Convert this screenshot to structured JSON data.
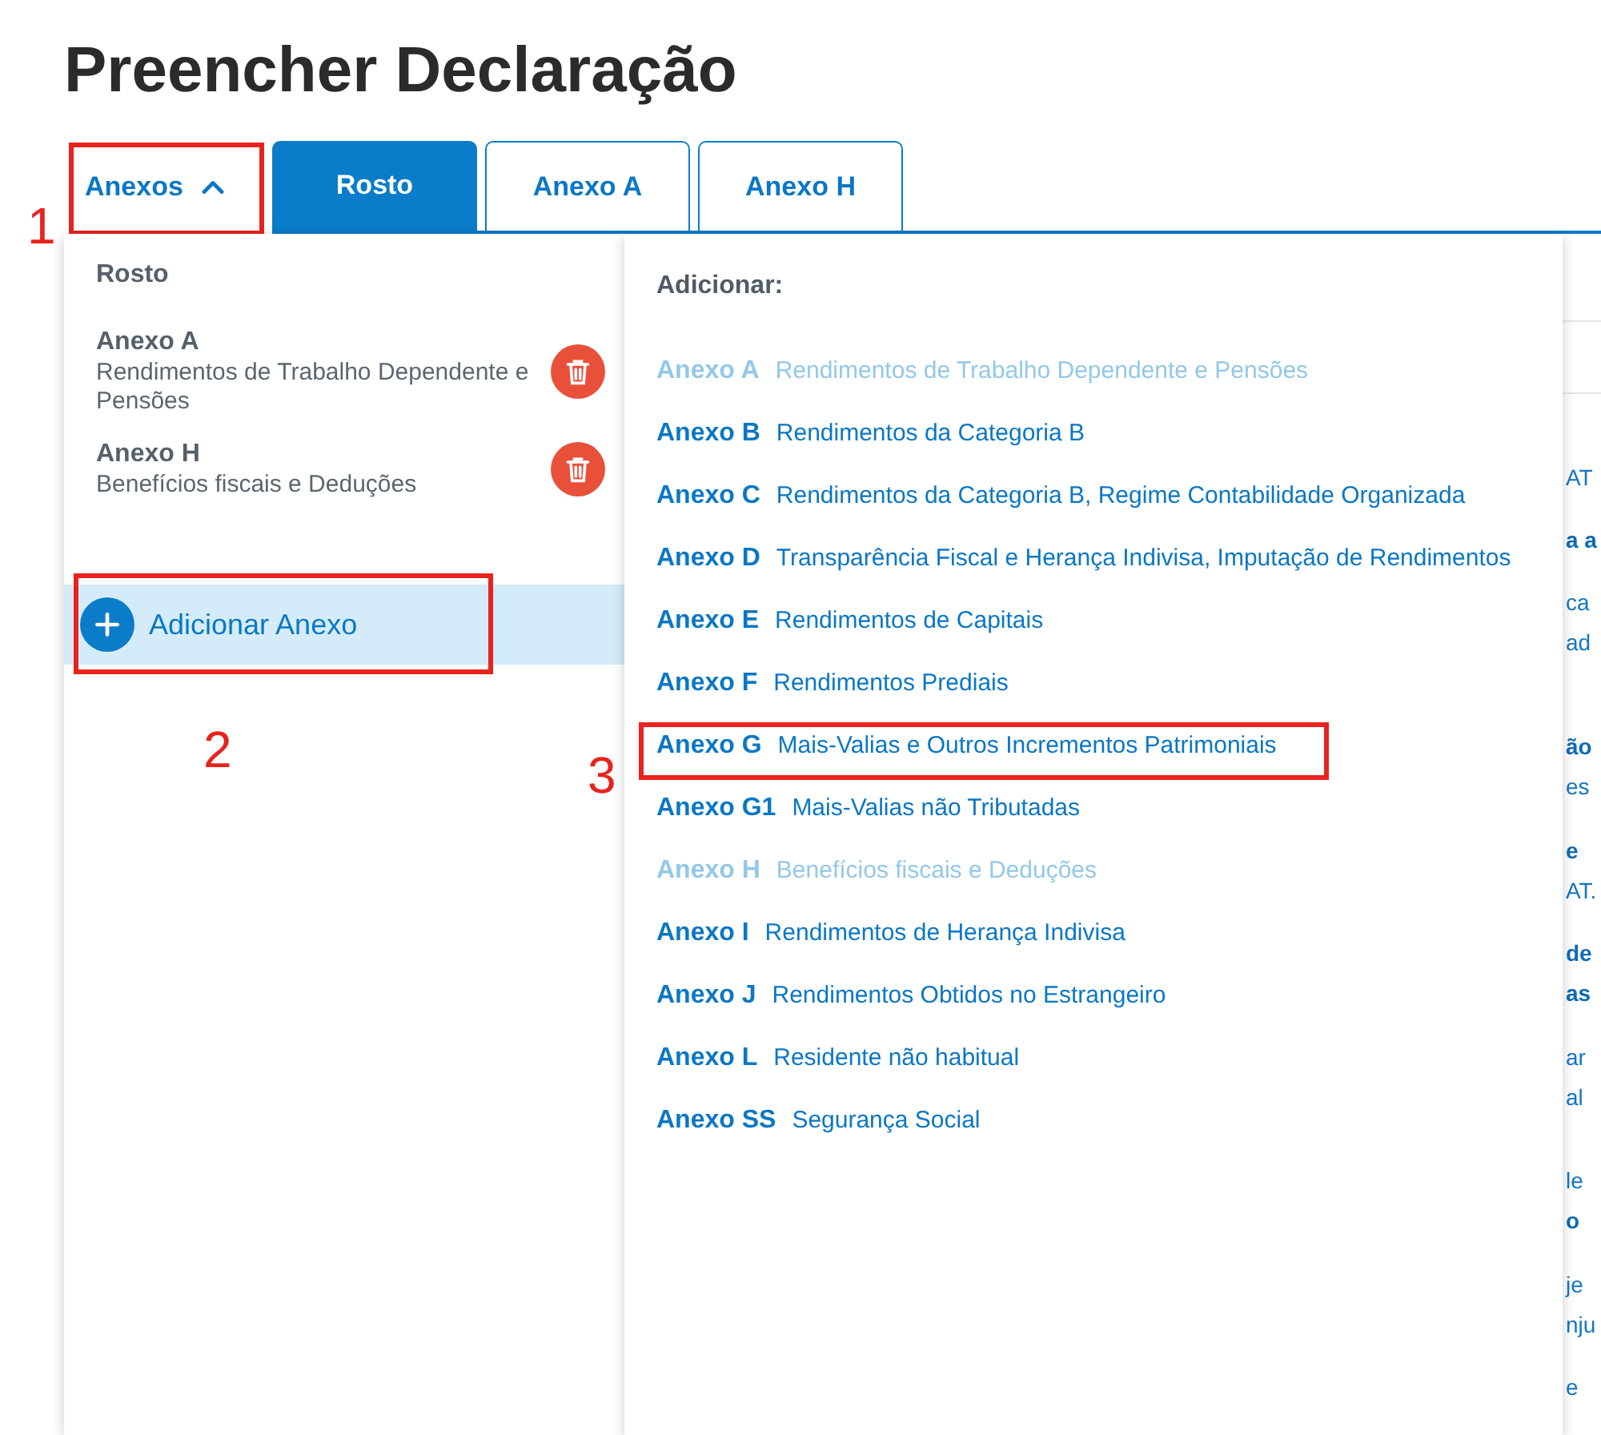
{
  "page_title": "Preencher Declaração",
  "annex_toggle": {
    "label": "Anexos",
    "expanded": true,
    "callout": "1"
  },
  "tabs": [
    {
      "label": "Rosto",
      "selected": true
    },
    {
      "label": "Anexo A",
      "selected": false
    },
    {
      "label": "Anexo H",
      "selected": false
    }
  ],
  "attached_annexes": [
    {
      "name": "Rosto",
      "deletable": false
    },
    {
      "name": "Anexo A",
      "description": "Rendimentos de Trabalho Dependente e Pensões",
      "deletable": true
    },
    {
      "name": "Anexo H",
      "description": "Benefícios fiscais e Deduções",
      "deletable": true
    }
  ],
  "add_button": {
    "label": "Adicionar Anexo",
    "callout": "2"
  },
  "add_menu": {
    "heading": "Adicionar:",
    "items": [
      {
        "code": "Anexo A",
        "description": "Rendimentos de Trabalho Dependente e Pensões",
        "disabled": true
      },
      {
        "code": "Anexo B",
        "description": "Rendimentos da Categoria B",
        "disabled": false
      },
      {
        "code": "Anexo C",
        "description": "Rendimentos da Categoria B, Regime Contabilidade Organizada",
        "disabled": false
      },
      {
        "code": "Anexo D",
        "description": "Transparência Fiscal e Herança Indivisa, Imputação de Rendimentos",
        "disabled": false
      },
      {
        "code": "Anexo E",
        "description": "Rendimentos de Capitais",
        "disabled": false
      },
      {
        "code": "Anexo F",
        "description": "Rendimentos Prediais",
        "disabled": false
      },
      {
        "code": "Anexo G",
        "description": "Mais-Valias e Outros Incrementos Patrimoniais",
        "disabled": false,
        "callout": "3"
      },
      {
        "code": "Anexo G1",
        "description": "Mais-Valias não Tributadas",
        "disabled": false
      },
      {
        "code": "Anexo H",
        "description": "Benefícios fiscais e Deduções",
        "disabled": true
      },
      {
        "code": "Anexo I",
        "description": "Rendimentos de Herança Indivisa",
        "disabled": false
      },
      {
        "code": "Anexo J",
        "description": "Rendimentos Obtidos no Estrangeiro",
        "disabled": false
      },
      {
        "code": "Anexo L",
        "description": "Residente não habitual",
        "disabled": false
      },
      {
        "code": "Anexo SS",
        "description": "Segurança Social",
        "disabled": false
      }
    ]
  },
  "background_text": [
    {
      "lines": [
        {
          "text": "AT",
          "bold": false
        }
      ]
    },
    {
      "lines": [
        {
          "text": "a a",
          "bold": true
        }
      ]
    },
    {
      "lines": [
        {
          "text": "ca",
          "bold": false
        },
        {
          "text": "ad",
          "bold": false
        }
      ]
    },
    {
      "lines": [
        {
          "text": "ão",
          "bold": true
        },
        {
          "text": "es",
          "bold": false
        }
      ]
    },
    {
      "lines": [
        {
          "text": "e",
          "bold": true
        },
        {
          "text": "AT.",
          "bold": false
        }
      ]
    },
    {
      "lines": [
        {
          "text": "de",
          "bold": true
        },
        {
          "text": "as",
          "bold": true
        }
      ]
    },
    {
      "lines": [
        {
          "text": "ar",
          "bold": false
        },
        {
          "text": "al",
          "bold": false
        }
      ]
    },
    {
      "lines": [
        {
          "text": "le",
          "bold": false
        },
        {
          "text": "o",
          "bold": true
        }
      ]
    },
    {
      "lines": [
        {
          "text": "je",
          "bold": false
        },
        {
          "text": "nju",
          "bold": false
        }
      ]
    },
    {
      "lines": [
        {
          "text": "e",
          "bold": false
        }
      ]
    }
  ]
}
